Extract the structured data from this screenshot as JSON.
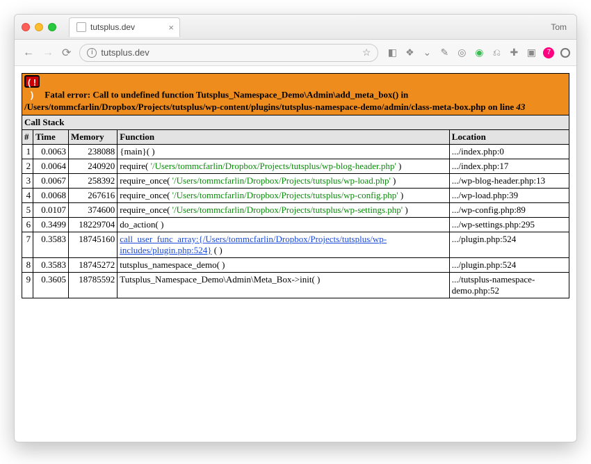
{
  "window": {
    "user_label": "Tom",
    "tab_title": "tutsplus.dev",
    "url": "tutsplus.dev"
  },
  "error": {
    "prefix": "Fatal error:",
    "message_a": " Call to undefined function Tutsplus_Namespace_Demo\\Admin\\add_meta_box() in ",
    "file": "/Users/tommcfarlin/Dropbox/Projects/tutsplus/wp-content/plugins/tutsplus-namespace-demo/admin/class-meta-box.php",
    "on_line": " on line ",
    "line": "43"
  },
  "headers": {
    "callstack": "Call Stack",
    "idx": "#",
    "time": "Time",
    "memory": "Memory",
    "function": "Function",
    "location": "Location"
  },
  "rows": [
    {
      "idx": "1",
      "time": "0.0063",
      "memory": "238088",
      "fn_pre": "{main}( )",
      "fn_path": "",
      "fn_post": "",
      "loc": ".../index.php:0"
    },
    {
      "idx": "2",
      "time": "0.0064",
      "memory": "240920",
      "fn_pre": "require( ",
      "fn_path": "'/Users/tommcfarlin/Dropbox/Projects/tutsplus/wp-blog-header.php'",
      "fn_post": " )",
      "loc": ".../index.php:17"
    },
    {
      "idx": "3",
      "time": "0.0067",
      "memory": "258392",
      "fn_pre": "require_once( ",
      "fn_path": "'/Users/tommcfarlin/Dropbox/Projects/tutsplus/wp-load.php'",
      "fn_post": " )",
      "loc": ".../wp-blog-header.php:13"
    },
    {
      "idx": "4",
      "time": "0.0068",
      "memory": "267616",
      "fn_pre": "require_once( ",
      "fn_path": "'/Users/tommcfarlin/Dropbox/Projects/tutsplus/wp-config.php'",
      "fn_post": " )",
      "loc": ".../wp-load.php:39"
    },
    {
      "idx": "5",
      "time": "0.0107",
      "memory": "374600",
      "fn_pre": "require_once( ",
      "fn_path": "'/Users/tommcfarlin/Dropbox/Projects/tutsplus/wp-settings.php'",
      "fn_post": " )",
      "loc": ".../wp-config.php:89"
    },
    {
      "idx": "6",
      "time": "0.3499",
      "memory": "18229704",
      "fn_pre": "do_action( )",
      "fn_path": "",
      "fn_post": "",
      "loc": ".../wp-settings.php:295"
    },
    {
      "idx": "7",
      "time": "0.3583",
      "memory": "18745160",
      "fn_pre": "",
      "fn_link": "call_user_func_array:{/Users/tommcfarlin/Dropbox/Projects/tutsplus/wp-includes/plugin.php:524}",
      "fn_post": " ( )",
      "loc": ".../plugin.php:524"
    },
    {
      "idx": "8",
      "time": "0.3583",
      "memory": "18745272",
      "fn_pre": "tutsplus_namespace_demo( )",
      "fn_path": "",
      "fn_post": "",
      "loc": ".../plugin.php:524"
    },
    {
      "idx": "9",
      "time": "0.3605",
      "memory": "18785592",
      "fn_pre": "Tutsplus_Namespace_Demo\\Admin\\Meta_Box->init( )",
      "fn_path": "",
      "fn_post": "",
      "loc": ".../tutsplus-namespace-demo.php:52"
    }
  ]
}
